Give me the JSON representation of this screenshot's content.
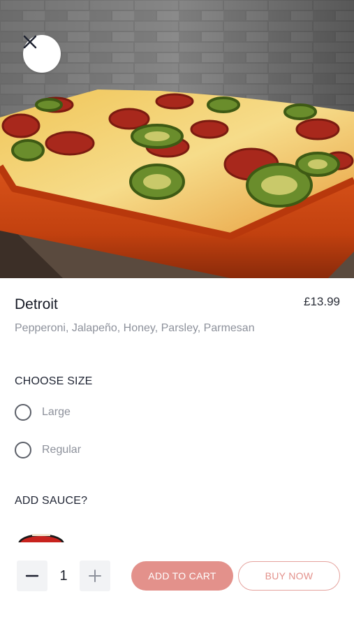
{
  "hero": {
    "image": "detroit-pizza-photo"
  },
  "product": {
    "name": "Detroit",
    "price": "£13.99",
    "description": "Pepperoni, Jalapeño, Honey, Parsley, Parmesan"
  },
  "size_section": {
    "title": "CHOOSE SIZE",
    "options": [
      {
        "label": "Large",
        "selected": false
      },
      {
        "label": "Regular",
        "selected": false
      }
    ]
  },
  "sauce_section": {
    "title": "ADD SAUCE?"
  },
  "bottom_bar": {
    "quantity": "1",
    "add_to_cart_label": "ADD TO CART",
    "buy_now_label": "BUY NOW"
  },
  "icons": {
    "close": "close-icon",
    "minus": "minus-icon",
    "plus": "plus-icon"
  },
  "colors": {
    "accent": "#e3918b",
    "accent_border": "#e5a29d",
    "text_muted": "#8d919b"
  }
}
